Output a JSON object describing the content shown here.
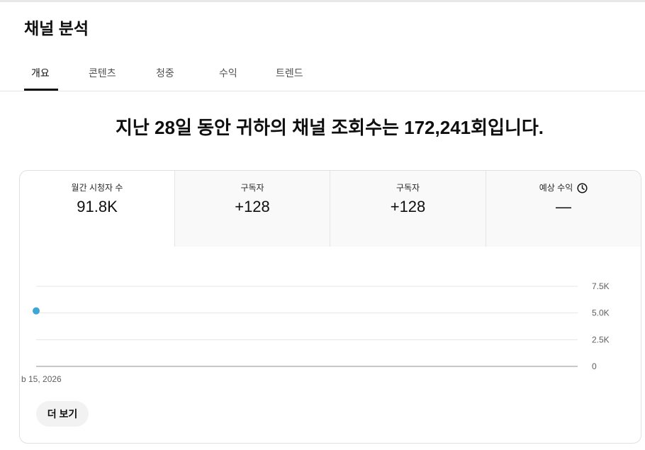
{
  "header": {
    "title": "채널 분석"
  },
  "tabs": [
    {
      "label": "개요",
      "selected": true
    },
    {
      "label": "콘텐츠",
      "selected": false
    },
    {
      "label": "청중",
      "selected": false
    },
    {
      "label": "수익",
      "selected": false
    },
    {
      "label": "트렌드",
      "selected": false
    }
  ],
  "headline": "지난 28일 동안 귀하의 채널 조회수는 172,241회입니다.",
  "metrics": [
    {
      "label": "월간 시청자 수",
      "value": "91.8K",
      "selected": true
    },
    {
      "label": "구독자",
      "value": "+128",
      "selected": false
    },
    {
      "label": "구독자",
      "value": "+128",
      "selected": false
    },
    {
      "label": "예상 수익",
      "value": "—",
      "selected": false,
      "icon": "clock-icon"
    }
  ],
  "more_button": {
    "label": "더 보기"
  },
  "colors": {
    "text": "#0f0f0f",
    "selected_tab_indicator": "#0f0f0f",
    "metric_inactive_bg": "#f9f9f9"
  },
  "chart_data": {
    "type": "line",
    "x": [
      "b 15, 2026"
    ],
    "series": [
      {
        "values": [
          5200
        ],
        "color": "#3ea6d6"
      }
    ],
    "ylim": [
      0,
      7500
    ],
    "y_ticks": [
      {
        "value": 7500,
        "label": "7.5K"
      },
      {
        "value": 5000,
        "label": "5.0K"
      },
      {
        "value": 2500,
        "label": "2.5K"
      },
      {
        "value": 0,
        "label": "0"
      }
    ],
    "grid": true,
    "y_axis_side": "right",
    "colors": {
      "grid": "#e5e5e5",
      "axis": "#909090",
      "tick_text": "#606060"
    }
  }
}
